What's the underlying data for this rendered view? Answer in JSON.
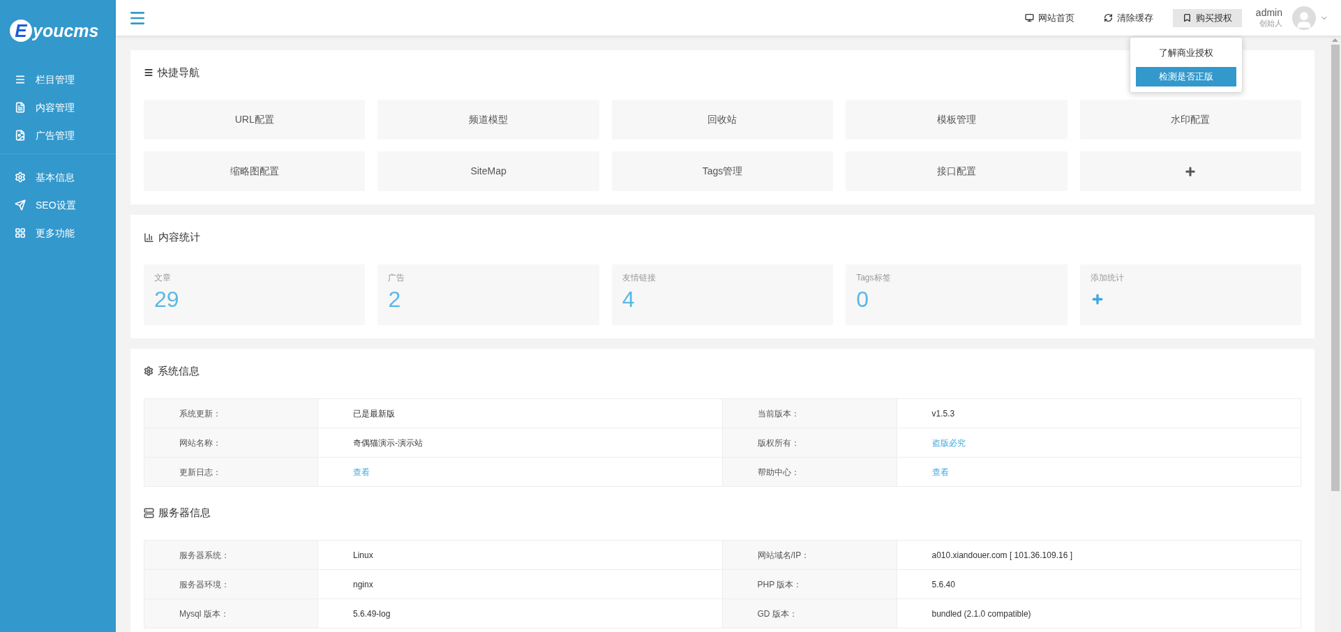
{
  "sidebar": {
    "logo": {
      "letter": "E",
      "text": "youcms"
    },
    "groups": [
      {
        "items": [
          {
            "label": "栏目管理",
            "kind": "list"
          },
          {
            "label": "内容管理",
            "kind": "file"
          },
          {
            "label": "广告管理",
            "kind": "image"
          }
        ]
      },
      {
        "items": [
          {
            "label": "基本信息",
            "kind": "gear"
          },
          {
            "label": "SEO设置",
            "kind": "plane"
          },
          {
            "label": "更多功能",
            "kind": "grid"
          }
        ]
      }
    ]
  },
  "header": {
    "links": [
      {
        "label": "网站首页",
        "kind": "monitor",
        "expanded": false
      },
      {
        "label": "清除缓存",
        "kind": "refresh",
        "expanded": false
      },
      {
        "label": "购买授权",
        "kind": "bookmark",
        "expanded": true
      }
    ],
    "user": {
      "name": "admin",
      "role": "创始人"
    },
    "dropdown": [
      {
        "label": "了解商业授权",
        "selected": false
      },
      {
        "label": "检测是否正版",
        "selected": true
      }
    ]
  },
  "quick_nav": {
    "title": "快捷导航",
    "items": [
      {
        "label": "URL配置",
        "kind": "text"
      },
      {
        "label": "频道模型",
        "kind": "text"
      },
      {
        "label": "回收站",
        "kind": "text"
      },
      {
        "label": "模板管理",
        "kind": "text"
      },
      {
        "label": "水印配置",
        "kind": "text"
      },
      {
        "label": "缩略图配置",
        "kind": "text"
      },
      {
        "label": "SiteMap",
        "kind": "text"
      },
      {
        "label": "Tags管理",
        "kind": "text"
      },
      {
        "label": "接口配置",
        "kind": "text"
      },
      {
        "kind": "add"
      }
    ]
  },
  "stats": {
    "title": "内容统计",
    "items": [
      {
        "label": "文章",
        "value": "29",
        "kind": "count"
      },
      {
        "label": "广告",
        "value": "2",
        "kind": "count"
      },
      {
        "label": "友情链接",
        "value": "4",
        "kind": "count"
      },
      {
        "label": "Tags标签",
        "value": "0",
        "kind": "count"
      },
      {
        "label": "添加统计",
        "kind": "add"
      }
    ]
  },
  "sections": [
    {
      "title": "系统信息",
      "kind": "gear",
      "rows": [
        [
          {
            "label": "系统更新：",
            "value": "已是最新版",
            "link": false
          },
          {
            "label": "当前版本：",
            "value": "v1.5.3",
            "link": false
          }
        ],
        [
          {
            "label": "网站名称：",
            "value": "奇偶猫演示-演示站",
            "link": false
          },
          {
            "label": "版权所有：",
            "value": "盗版必究",
            "link": true
          }
        ],
        [
          {
            "label": "更新日志：",
            "value": "查看",
            "link": true
          },
          {
            "label": "帮助中心：",
            "value": "查看",
            "link": true
          }
        ]
      ]
    },
    {
      "title": "服务器信息",
      "kind": "server",
      "rows": [
        [
          {
            "label": "服务器系统：",
            "value": "Linux",
            "link": false
          },
          {
            "label": "网站域名/IP：",
            "value": "a010.xiandouer.com [ 101.36.109.16 ]",
            "link": false
          }
        ],
        [
          {
            "label": "服务器环境：",
            "value": "nginx",
            "link": false
          },
          {
            "label": "PHP 版本：",
            "value": "5.6.40",
            "link": false
          }
        ],
        [
          {
            "label": "Mysql 版本：",
            "value": "5.6.49-log",
            "link": false
          },
          {
            "label": "GD 版本：",
            "value": "bundled (2.1.0 compatible)",
            "link": false
          }
        ]
      ]
    }
  ]
}
